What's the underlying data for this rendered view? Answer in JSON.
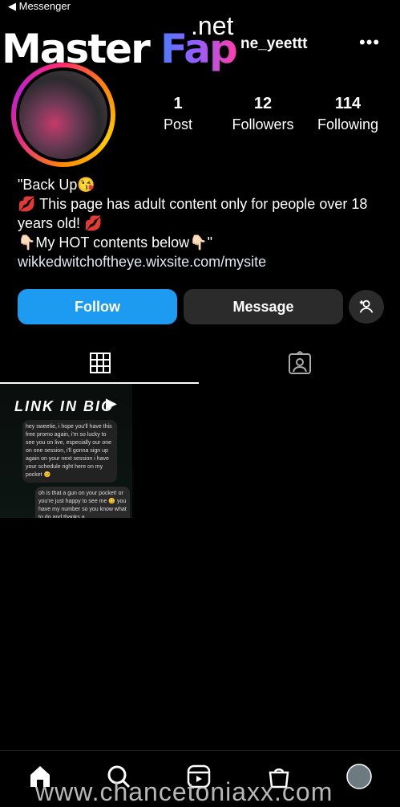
{
  "status_bar": {
    "back_label": "◀ Messenger"
  },
  "watermark": {
    "master": "Master",
    "fap": "Fap",
    "net": ".net",
    "bottom": "www.chancetoniaxx.com"
  },
  "header": {
    "username": "ne_yeettt",
    "more_icon": "more-icon"
  },
  "profile": {
    "stats": [
      {
        "value": "1",
        "label": "Post"
      },
      {
        "value": "12",
        "label": "Followers"
      },
      {
        "value": "114",
        "label": "Following"
      }
    ],
    "bio": [
      "\"Back Up😘",
      "💋 This page has adult content only for people over 18 years old! 💋",
      "👇🏻My HOT contents below👇🏻\""
    ],
    "link": "wikkedwitchoftheye.wixsite.com/mysite"
  },
  "actions": {
    "follow": "Follow",
    "message": "Message"
  },
  "post": {
    "title": "LINK IN BIO",
    "bubble1": "hey sweetie, i hope you'll have this free promo again, i'm so lucky to see you on live, especially our one on one session, i'll gonna sign up again on your next session i have your schedule right here on my pocket 😊",
    "bubble2": "oh is that a gun on your pocket! or you're just happy to see me 😊 you have my number so you know what to do and thanks a"
  },
  "colors": {
    "accent": "#1d9bf0",
    "button_dark": "#2b2b2b"
  }
}
